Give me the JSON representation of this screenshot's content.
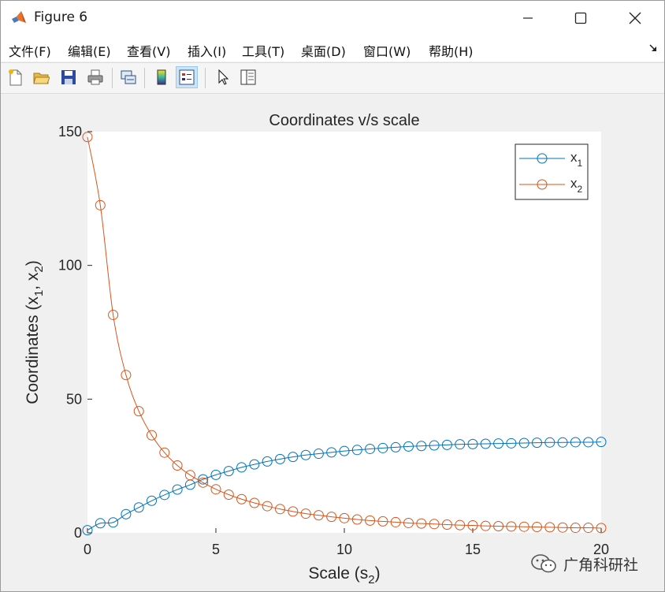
{
  "window": {
    "title": "Figure 6",
    "controls": {
      "minimize": "minimize-icon",
      "maximize": "maximize-icon",
      "close": "close-icon"
    }
  },
  "menu": {
    "items": [
      "文件(F)",
      "编辑(E)",
      "查看(V)",
      "插入(I)",
      "工具(T)",
      "桌面(D)",
      "窗口(W)",
      "帮助(H)"
    ]
  },
  "toolbar": {
    "buttons": [
      "new-figure-icon",
      "open-file-icon",
      "save-icon",
      "print-icon",
      "link-plot-icon",
      "colorbar-icon",
      "legend-icon",
      "pointer-icon",
      "property-inspector-icon"
    ]
  },
  "colors": {
    "x1": "#0072BD",
    "x2": "#D95319"
  },
  "chart_data": {
    "type": "line",
    "title": "Coordinates v/s scale",
    "xlabel": "Scale (s2)",
    "ylabel": "Coordinates (x1, x2)",
    "xlim": [
      0,
      20
    ],
    "ylim": [
      0,
      150
    ],
    "xticks": [
      0,
      5,
      10,
      15,
      20
    ],
    "yticks": [
      0,
      50,
      100,
      150
    ],
    "grid": false,
    "legend_position": "top-right",
    "marker": "circle",
    "x": [
      0,
      0.5,
      1,
      1.5,
      2,
      2.5,
      3,
      3.5,
      4,
      4.5,
      5,
      5.5,
      6,
      6.5,
      7,
      7.5,
      8,
      8.5,
      9,
      9.5,
      10,
      10.5,
      11,
      11.5,
      12,
      12.5,
      13,
      13.5,
      14,
      14.5,
      15,
      15.5,
      16,
      16.5,
      17,
      17.5,
      18,
      18.5,
      19,
      19.5,
      20
    ],
    "series": [
      {
        "name": "x1",
        "values": [
          1.0,
          3.6,
          3.9,
          7.0,
          9.5,
          12.0,
          14.2,
          16.2,
          18.0,
          20.0,
          21.7,
          23.1,
          24.5,
          25.6,
          26.7,
          27.6,
          28.4,
          29.1,
          29.6,
          30.1,
          30.6,
          31.0,
          31.4,
          31.7,
          32.0,
          32.3,
          32.5,
          32.7,
          32.9,
          33.1,
          33.2,
          33.3,
          33.4,
          33.5,
          33.6,
          33.7,
          33.8,
          33.8,
          33.9,
          33.9,
          34.0
        ]
      },
      {
        "name": "x2",
        "values": [
          148.0,
          122.5,
          81.5,
          59.0,
          45.5,
          36.5,
          30.0,
          25.2,
          21.6,
          18.8,
          16.3,
          14.3,
          12.6,
          11.2,
          10.0,
          8.9,
          8.0,
          7.2,
          6.6,
          6.0,
          5.5,
          5.0,
          4.6,
          4.3,
          4.0,
          3.7,
          3.5,
          3.3,
          3.1,
          2.9,
          2.8,
          2.6,
          2.5,
          2.4,
          2.3,
          2.2,
          2.1,
          2.0,
          1.9,
          1.9,
          1.8
        ]
      }
    ]
  },
  "labels": {
    "ylabel_prefix": "Coordinates (x",
    "ylabel_sub1": "1",
    "ylabel_mid": ", x",
    "ylabel_sub2": "2",
    "ylabel_suffix": ")",
    "xlabel_prefix": "Scale (s",
    "xlabel_sub": "2",
    "xlabel_suffix": ")",
    "legend": [
      {
        "base": "x",
        "sub": "1"
      },
      {
        "base": "x",
        "sub": "2"
      }
    ]
  },
  "watermark": {
    "text": "广角科研社",
    "icon": "wechat-icon"
  }
}
